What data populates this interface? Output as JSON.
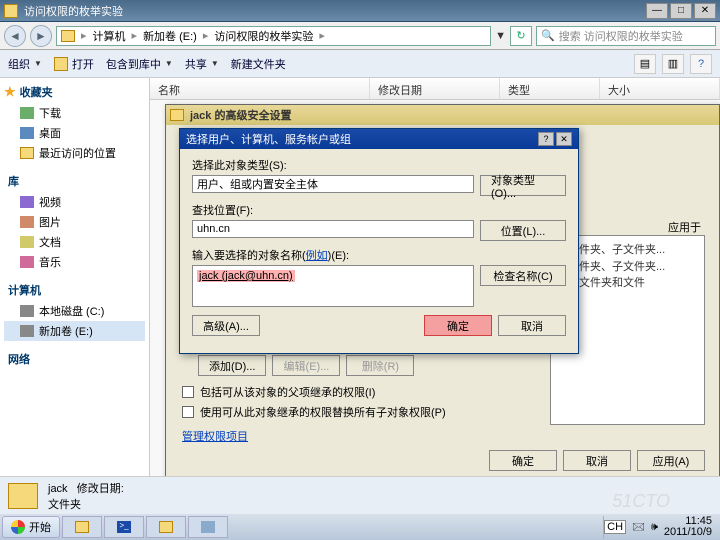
{
  "window": {
    "title": "访问权限的枚举实验",
    "min": "—",
    "max": "□",
    "close": "✕"
  },
  "address": {
    "back": "◄",
    "fwd": "►",
    "seg1": "计算机",
    "seg2": "新加卷 (E:)",
    "seg3": "访问权限的枚举实验",
    "refresh": "↻",
    "search_placeholder": "搜索 访问权限的枚举实验"
  },
  "toolbar": {
    "organize": "组织",
    "open": "打开",
    "include": "包含到库中",
    "share": "共享",
    "newfolder": "新建文件夹"
  },
  "nav": {
    "fav": "收藏夹",
    "fav_items": [
      "下载",
      "桌面",
      "最近访问的位置"
    ],
    "lib": "库",
    "lib_items": [
      "视频",
      "图片",
      "文档",
      "音乐"
    ],
    "comp": "计算机",
    "comp_items": [
      "本地磁盘 (C:)",
      "新加卷 (E:)"
    ],
    "net": "网络"
  },
  "columns": {
    "name": "名称",
    "date": "修改日期",
    "type": "类型",
    "size": "大小"
  },
  "dlg1": {
    "title": "jack 的高级安全设置",
    "perm_header": "应用于",
    "perm_lines": [
      "此文件夹、子文件夹...",
      "此文件夹、子文件夹...",
      "仅子文件夹和文件"
    ],
    "add": "添加(D)...",
    "edit": "编辑(E)...",
    "del": "删除(R)",
    "chk1": "包括可从该对象的父项继承的权限(I)",
    "chk2": "使用可从此对象继承的权限替换所有子对象权限(P)",
    "manage": "管理权限项目",
    "ok": "确定",
    "cancel": "取消",
    "apply": "应用(A)"
  },
  "dlg2": {
    "title": "选择用户、计算机、服务帐户或组",
    "help": "?",
    "close": "✕",
    "objtype_lbl": "选择此对象类型(S):",
    "objtype_val": "用户、组或内置安全主体",
    "objtype_btn": "对象类型(O)...",
    "loc_lbl": "查找位置(F):",
    "loc_val": "uhn.cn",
    "loc_btn": "位置(L)...",
    "name_lbl": "输入要选择的对象名称(",
    "name_example": "例如",
    "name_lbl2": ")(E):",
    "name_val": "jack (jack@uhn.cn)",
    "check_btn": "检查名称(C)",
    "adv_btn": "高级(A)...",
    "ok": "确定",
    "cancel": "取消"
  },
  "statusbar": {
    "name": "jack",
    "label": "修改日期:",
    "type": "文件夹"
  },
  "taskbar": {
    "start": "开始",
    "ch": "CH",
    "time": "11:45",
    "date": "2011/10/9"
  }
}
